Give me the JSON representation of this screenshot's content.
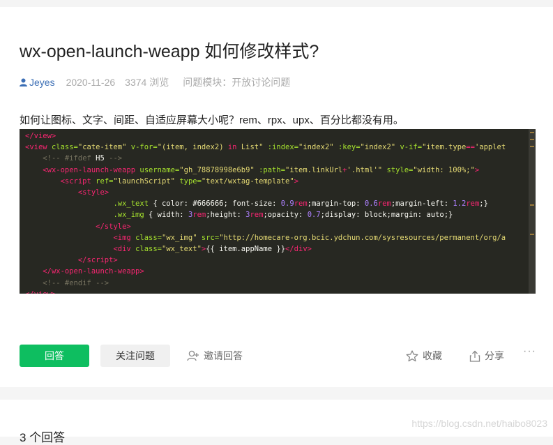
{
  "question": {
    "title": "wx-open-launch-weapp 如何修改样式?",
    "author": "Jeyes",
    "date": "2020-11-26",
    "views": "3374 浏览",
    "module_label": "问题模块：",
    "module_value": "开放讨论问题",
    "body": "如何让图标、文字、间距、自适应屏幕大小呢？rem、rpx、upx、百分比都没有用。"
  },
  "actions": {
    "answer": "回答",
    "follow": "关注问题",
    "invite": "邀请回答",
    "collect": "收藏",
    "share": "分享",
    "more": "···"
  },
  "answers": {
    "count_label": "3 个回答"
  },
  "watermark": "https://blog.csdn.net/haibo8023",
  "colors": {
    "answer_button": "#0ebe60",
    "author_link": "#3b6eb5",
    "code_background": "#272822"
  }
}
